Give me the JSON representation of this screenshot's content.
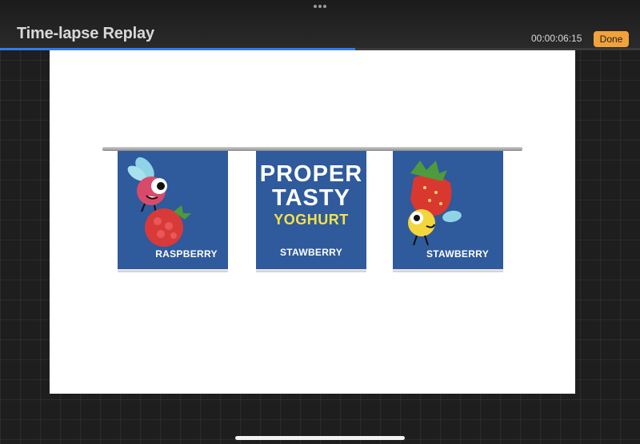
{
  "header": {
    "title": "Time-lapse Replay",
    "timecode": "00:00:06:15",
    "done_label": "Done"
  },
  "playback": {
    "progress": 0.555
  },
  "artwork": {
    "cups": [
      {
        "flavor": "RASPBERRY",
        "character": "pink-fly-with-raspberry"
      },
      {
        "brand_line1": "PROPER",
        "brand_line2": "TASTY",
        "brand_line3": "YOGHURT",
        "flavor": "STAWBERRY"
      },
      {
        "flavor": "STAWBERRY",
        "character": "yellow-bee-with-strawberry"
      }
    ]
  },
  "colors": {
    "accent_done": "#f2a23a",
    "progress": "#2d7cf3",
    "cup_blue": "#2f5a9c",
    "brand_yellow": "#f5e14a"
  }
}
